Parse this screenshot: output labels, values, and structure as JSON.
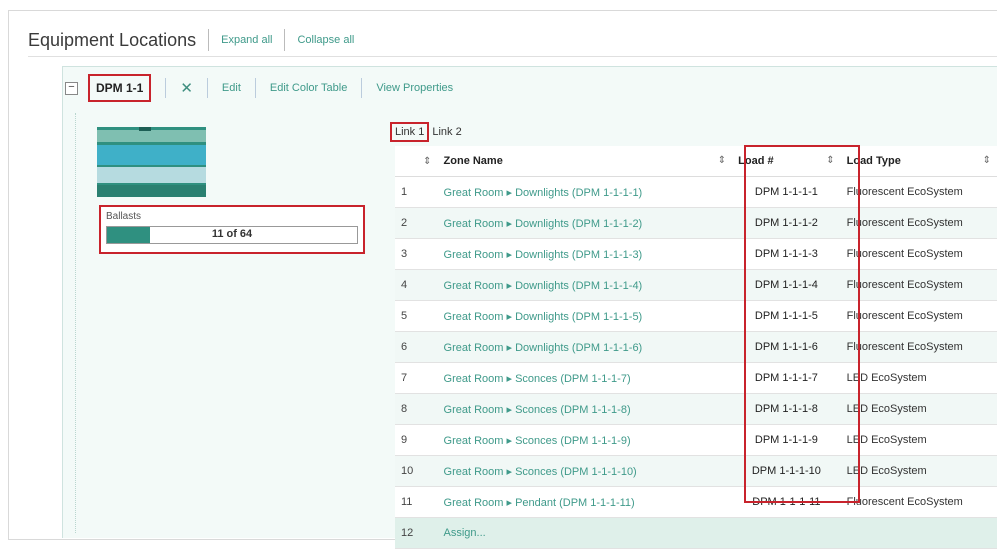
{
  "header": {
    "title": "Equipment Locations",
    "expand_all": "Expand all",
    "collapse_all": "Collapse all"
  },
  "toolbar": {
    "device_name": "DPM 1-1",
    "collapse_symbol": "−",
    "close_symbol": "✕",
    "edit": "Edit",
    "edit_color_table": "Edit Color Table",
    "view_properties": "View Properties"
  },
  "ballasts": {
    "label": "Ballasts",
    "text": "11 of 64",
    "current": 11,
    "total": 64
  },
  "links": {
    "tabs": [
      "Link 1",
      "Link 2"
    ],
    "active": "Link 1"
  },
  "table": {
    "headers": {
      "num": "",
      "zone": "Zone Name",
      "load": "Load #",
      "type": "Load Type"
    },
    "sort_icon": "⇕",
    "rows": [
      {
        "num": "1",
        "zone": "Great Room ▸ Downlights (DPM 1-1-1-1)",
        "load": "DPM 1-1-1-1",
        "type": "Fluorescent EcoSystem"
      },
      {
        "num": "2",
        "zone": "Great Room ▸ Downlights (DPM 1-1-1-2)",
        "load": "DPM 1-1-1-2",
        "type": "Fluorescent EcoSystem"
      },
      {
        "num": "3",
        "zone": "Great Room ▸ Downlights (DPM 1-1-1-3)",
        "load": "DPM 1-1-1-3",
        "type": "Fluorescent EcoSystem"
      },
      {
        "num": "4",
        "zone": "Great Room ▸ Downlights (DPM 1-1-1-4)",
        "load": "DPM 1-1-1-4",
        "type": "Fluorescent EcoSystem"
      },
      {
        "num": "5",
        "zone": "Great Room ▸ Downlights (DPM 1-1-1-5)",
        "load": "DPM 1-1-1-5",
        "type": "Fluorescent EcoSystem"
      },
      {
        "num": "6",
        "zone": "Great Room ▸ Downlights (DPM 1-1-1-6)",
        "load": "DPM 1-1-1-6",
        "type": "Fluorescent EcoSystem"
      },
      {
        "num": "7",
        "zone": "Great Room ▸ Sconces (DPM 1-1-1-7)",
        "load": "DPM 1-1-1-7",
        "type": "LED EcoSystem"
      },
      {
        "num": "8",
        "zone": "Great Room ▸ Sconces (DPM 1-1-1-8)",
        "load": "DPM 1-1-1-8",
        "type": "LED EcoSystem"
      },
      {
        "num": "9",
        "zone": "Great Room ▸ Sconces (DPM 1-1-1-9)",
        "load": "DPM 1-1-1-9",
        "type": "LED EcoSystem"
      },
      {
        "num": "10",
        "zone": "Great Room ▸ Sconces (DPM 1-1-1-10)",
        "load": "DPM 1-1-1-10",
        "type": "LED EcoSystem"
      },
      {
        "num": "11",
        "zone": "Great Room ▸ Pendant (DPM 1-1-1-11)",
        "load": "DPM 1-1-1-11",
        "type": "Fluorescent EcoSystem"
      }
    ],
    "assign_row": {
      "num": "12",
      "label": "Assign..."
    }
  },
  "colors": {
    "accent": "#3f9a8a",
    "highlight": "#c8232c",
    "progress_fill": "#2f9080"
  }
}
